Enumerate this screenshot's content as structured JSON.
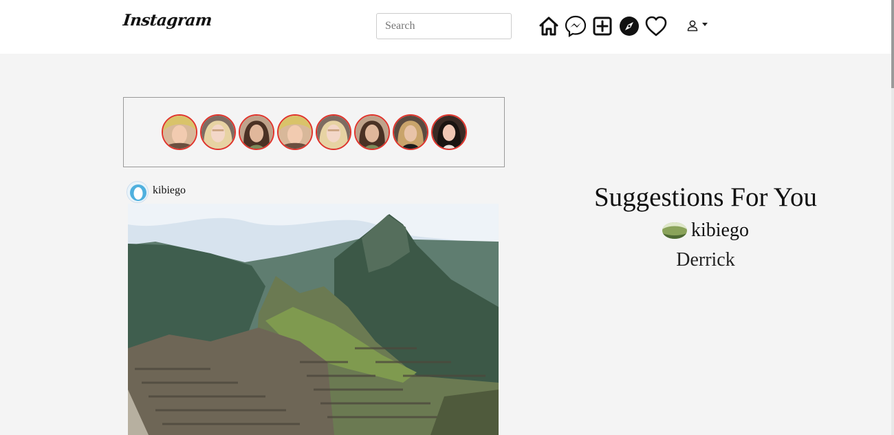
{
  "app": {
    "logo_text": "Instagram"
  },
  "search": {
    "placeholder": "Search",
    "value": ""
  },
  "nav": {
    "icons": [
      "home-icon",
      "messenger-icon",
      "new-post-icon",
      "explore-icon",
      "heart-icon"
    ],
    "profile_icon": "user-icon"
  },
  "stories": {
    "count": 8,
    "ring_color": "#e0332b"
  },
  "post": {
    "username": "kibiego",
    "image": "mountain-ruins-photo"
  },
  "suggestions": {
    "title": "Suggestions For You",
    "items": [
      {
        "username": "kibiego",
        "has_avatar": true
      },
      {
        "username": "Derrick",
        "has_avatar": false
      }
    ]
  },
  "colors": {
    "navbar_bg": "#ffffff",
    "page_bg": "#f4f4f4",
    "story_ring": "#e0332b"
  }
}
